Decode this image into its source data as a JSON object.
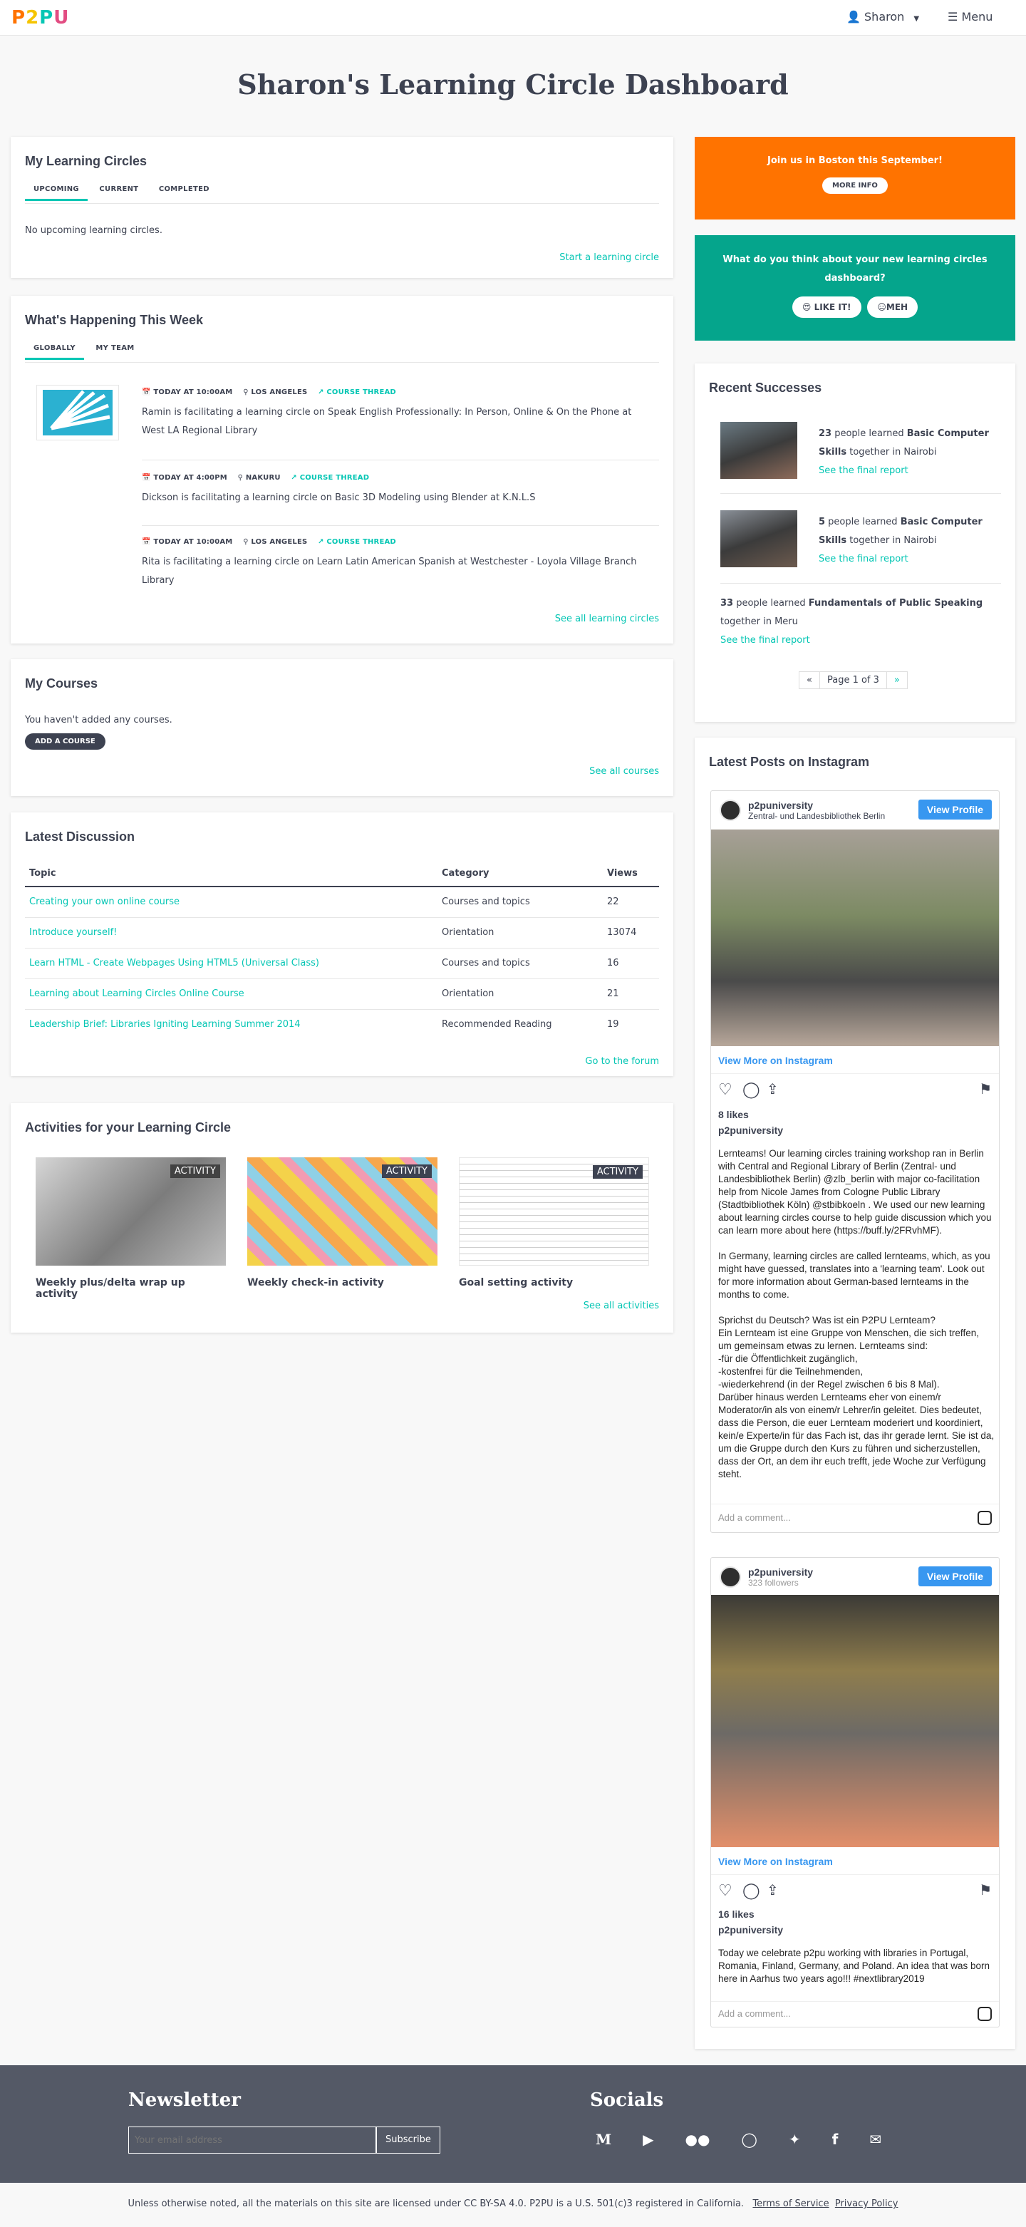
{
  "nav": {
    "logo": "P2PU",
    "user": "Sharon",
    "menu": "Menu",
    "logo_colors": [
      "#ff7300",
      "#f5c400",
      "#05c6b4",
      "#e24c82"
    ]
  },
  "page_title": "Sharon's Learning Circle Dashboard",
  "my_circles": {
    "title": "My Learning Circles",
    "tabs": [
      "UPCOMING",
      "CURRENT",
      "COMPLETED"
    ],
    "empty": "No upcoming learning circles.",
    "link": "Start a learning circle"
  },
  "happening": {
    "title": "What's Happening This Week",
    "tabs": [
      "GLOBALLY",
      "MY TEAM"
    ],
    "events": [
      {
        "time": "TODAY AT 10:00AM",
        "place": "LOS ANGELES",
        "thread": "COURSE THREAD",
        "text": "Ramin is facilitating a learning circle on Speak English Professionally: In Person, Online & On the Phone at West LA Regional Library"
      },
      {
        "time": "TODAY AT 4:00PM",
        "place": "NAKURU",
        "thread": "COURSE THREAD",
        "text": "Dickson is facilitating a learning circle on Basic 3D Modeling using Blender at K.N.L.S"
      },
      {
        "time": "TODAY AT 10:00AM",
        "place": "LOS ANGELES",
        "thread": "COURSE THREAD",
        "text": "Rita is facilitating a learning circle on Learn Latin American Spanish at Westchester - Loyola Village Branch Library"
      }
    ],
    "link": "See all learning circles"
  },
  "courses": {
    "title": "My Courses",
    "empty": "You haven't added any courses.",
    "button": "ADD A COURSE",
    "link": "See all courses"
  },
  "discussion": {
    "title": "Latest Discussion",
    "headers": [
      "Topic",
      "Category",
      "Views"
    ],
    "rows": [
      {
        "topic": "Creating your own online course",
        "category": "Courses and topics",
        "views": "22"
      },
      {
        "topic": "Introduce yourself!",
        "category": "Orientation",
        "views": "13074"
      },
      {
        "topic": "Learn HTML - Create Webpages Using HTML5 (Universal Class)",
        "category": "Courses and topics",
        "views": "16"
      },
      {
        "topic": "Learning about Learning Circles Online Course",
        "category": "Orientation",
        "views": "21"
      },
      {
        "topic": "Leadership Brief: Libraries Igniting Learning Summer 2014",
        "category": "Recommended Reading",
        "views": "19"
      }
    ],
    "link": "Go to the forum"
  },
  "activities": {
    "title": "Activities for your Learning Circle",
    "badge": "ACTIVITY",
    "items": [
      "Weekly plus/delta wrap up activity",
      "Weekly check-in activity",
      "Goal setting activity"
    ],
    "link": "See all activities"
  },
  "boston": {
    "text": "Join us in Boston this September!",
    "button": "MORE INFO"
  },
  "feedback": {
    "question": "What do you think about your new learning circles dashboard?",
    "like": "😍 LIKE IT!",
    "meh": "😑MEH"
  },
  "successes": {
    "title": "Recent Successes",
    "items": [
      {
        "count": "23",
        "pre": " people learned ",
        "course": "Basic Computer Skills",
        "post": " together in Nairobi",
        "link": "See the final report"
      },
      {
        "count": "5",
        "pre": " people learned ",
        "course": "Basic Computer Skills",
        "post": " together in Nairobi",
        "link": "See the final report"
      },
      {
        "count": "33",
        "pre": " people learned ",
        "course": "Fundamentals of Public Speaking",
        "post": " together in Meru",
        "link": "See the final report"
      }
    ],
    "pager": {
      "prev": "«",
      "label": "Page 1 of 3",
      "next": "»"
    }
  },
  "instagram": {
    "title": "Latest Posts on Instagram",
    "posts": [
      {
        "user": "p2puniversity",
        "sub": "Zentral- und Landesbibliothek Berlin",
        "view_profile": "View Profile",
        "more": "View More on Instagram",
        "likes": "8 likes",
        "author": "p2puniversity",
        "caption": "Lernteams! Our learning circles training workshop ran in Berlin with Central and Regional Library of Berlin (Zentral- und Landesbibliothek Berlin) @zlb_berlin with major co-facilitation help from Nicole James from Cologne Public Library (Stadtbibliothek Köln) @stbibkoeln . We used our new learning about learning circles course to help guide discussion which you can learn more about here (https://buff.ly/2FRvhMF).\n\nIn Germany, learning circles are called lernteams, which, as you might have guessed, translates into a 'learning team'. Look out for more information about German-based lernteams in the months to come.\n\nSprichst du Deutsch? Was ist ein P2PU Lernteam?\nEin Lernteam ist eine Gruppe von Menschen, die sich treffen, um gemeinsam etwas zu lernen. Lernteams sind:\n-für die Öffentlichkeit zugänglich,\n-kostenfrei für die Teilnehmenden,\n-wiederkehrend (in der Regel zwischen 6 bis 8 Mal).\nDarüber hinaus werden Lernteams eher von einem/r Moderator/in als von einem/r Lehrer/in geleitet. Dies bedeutet, dass die Person, die euer Lernteam moderiert und koordiniert, kein/e Experte/in für das Fach ist, das ihr gerade lernt. Sie ist da, um die Gruppe durch den Kurs zu führen und sicherzustellen, dass der Ort, an dem ihr euch trefft, jede Woche zur Verfügung steht.",
        "comment": "Add a comment..."
      },
      {
        "user": "p2puniversity",
        "sub": "323 followers",
        "view_profile": "View Profile",
        "more": "View More on Instagram",
        "likes": "16 likes",
        "author": "p2puniversity",
        "caption": "Today we celebrate p2pu working with libraries in Portugal, Romania, Finland, Germany, and Poland. An idea that was born here in Aarhus two years ago!!! #nextlibrary2019",
        "comment": "Add a comment..."
      }
    ]
  },
  "footer": {
    "newsletter": "Newsletter",
    "placeholder": "Your email address",
    "subscribe": "Subscribe",
    "socials": "Socials",
    "license": "Unless otherwise noted, all the materials on this site are licensed under CC BY-SA 4.0.  P2PU is a U.S. 501(c)3 registered in California.",
    "tos": "Terms of Service",
    "privacy": "Privacy Policy"
  },
  "colors": {
    "accent": "#05c6b4",
    "orange": "#ff7300",
    "teal": "#05a58c",
    "dark": "#3d4251",
    "footer": "#545966"
  }
}
